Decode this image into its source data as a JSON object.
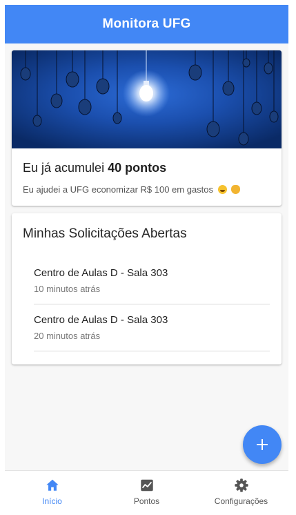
{
  "app": {
    "title": "Monitora UFG"
  },
  "hero": {
    "heading_prefix": "Eu já acumulei",
    "heading_points": "40 pontos",
    "subtitle": "Eu ajudei a UFG economizar R$ 100 em gastos"
  },
  "requests": {
    "title": "Minhas Solicitações Abertas",
    "items": [
      {
        "location": "Centro de Aulas D - Sala 303",
        "time": "10 minutos atrás"
      },
      {
        "location": "Centro de Aulas D - Sala 303",
        "time": "20 minutos atrás"
      }
    ]
  },
  "fab": {
    "icon": "plus-icon"
  },
  "nav": {
    "items": [
      {
        "label": "Início",
        "icon": "home-icon",
        "active": true
      },
      {
        "label": "Pontos",
        "icon": "chart-icon",
        "active": false
      },
      {
        "label": "Configurações",
        "icon": "gear-icon",
        "active": false
      }
    ]
  },
  "colors": {
    "primary": "#4287f5",
    "hero_bg": "#0d3b86"
  }
}
